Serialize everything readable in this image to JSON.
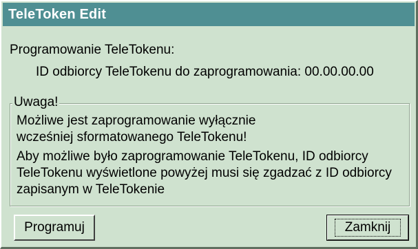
{
  "window": {
    "title": "TeleToken Edit"
  },
  "main": {
    "section_label": "Programowanie TeleTokenu:",
    "id_line": "ID odbiorcy TeleTokenu do zaprogramowania: 00.00.00.00"
  },
  "warning": {
    "legend": "Uwaga!",
    "paragraph1": "Możliwe jest zaprogramowanie wyłącznie wcześniej sformatowanego TeleTokenu!",
    "paragraph2": "Aby możliwe było zaprogramowanie TeleTokenu, ID odbiorcy TeleTokenu wyświetlone powyżej musi się zgadzać z ID odbiorcy zapisanym w TeleTokenie"
  },
  "buttons": {
    "program": "Programuj",
    "close": "Zamknij"
  }
}
